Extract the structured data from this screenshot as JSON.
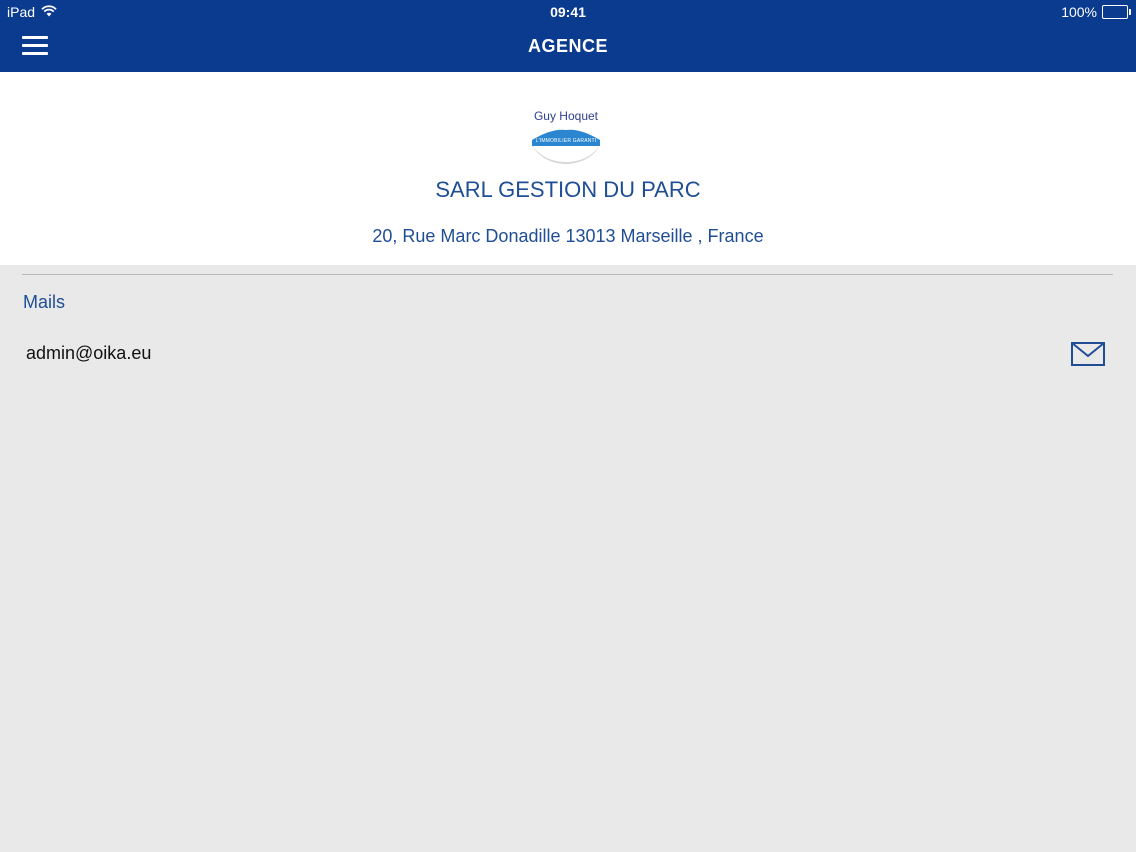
{
  "status_bar": {
    "device": "iPad",
    "time": "09:41",
    "battery": "100%",
    "wifi_icon": "wifi-icon",
    "battery_icon": "battery-icon"
  },
  "nav": {
    "title": "AGENCE",
    "menu_icon": "hamburger-menu-icon"
  },
  "agency": {
    "logo_text": "Guy Hoquet",
    "logo_subtext": "L'IMMOBILIER GARANTI",
    "name": "SARL GESTION DU PARC",
    "address": "20, Rue Marc Donadille 13013 Marseille , France"
  },
  "mails": {
    "section_title": "Mails",
    "items": [
      {
        "email": "admin@oika.eu",
        "action_icon": "envelope-icon"
      }
    ]
  },
  "colors": {
    "nav_background": "#0b3b8f",
    "accent_text": "#1f4e94",
    "page_background": "#e9e9ea",
    "card_background": "#ffffff"
  }
}
